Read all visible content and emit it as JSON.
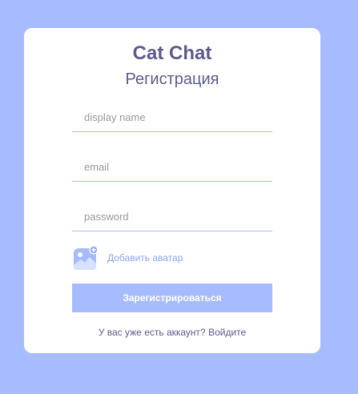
{
  "app": {
    "title": "Cat Chat",
    "subtitle": "Регистрация"
  },
  "form": {
    "display_name_placeholder": "display name",
    "email_placeholder": "email",
    "password_placeholder": "password",
    "avatar_label": "Добавить аватар",
    "submit_label": "Зарегистрироваться"
  },
  "footer": {
    "prompt": "У вас уже есть аккаунт?",
    "login_link": "Войдите"
  },
  "icons": {
    "avatar": "add-image-icon"
  },
  "colors": {
    "background": "#a7bcff",
    "accent": "#8da4f1",
    "title": "#5d5b8d",
    "card": "#ffffff"
  }
}
